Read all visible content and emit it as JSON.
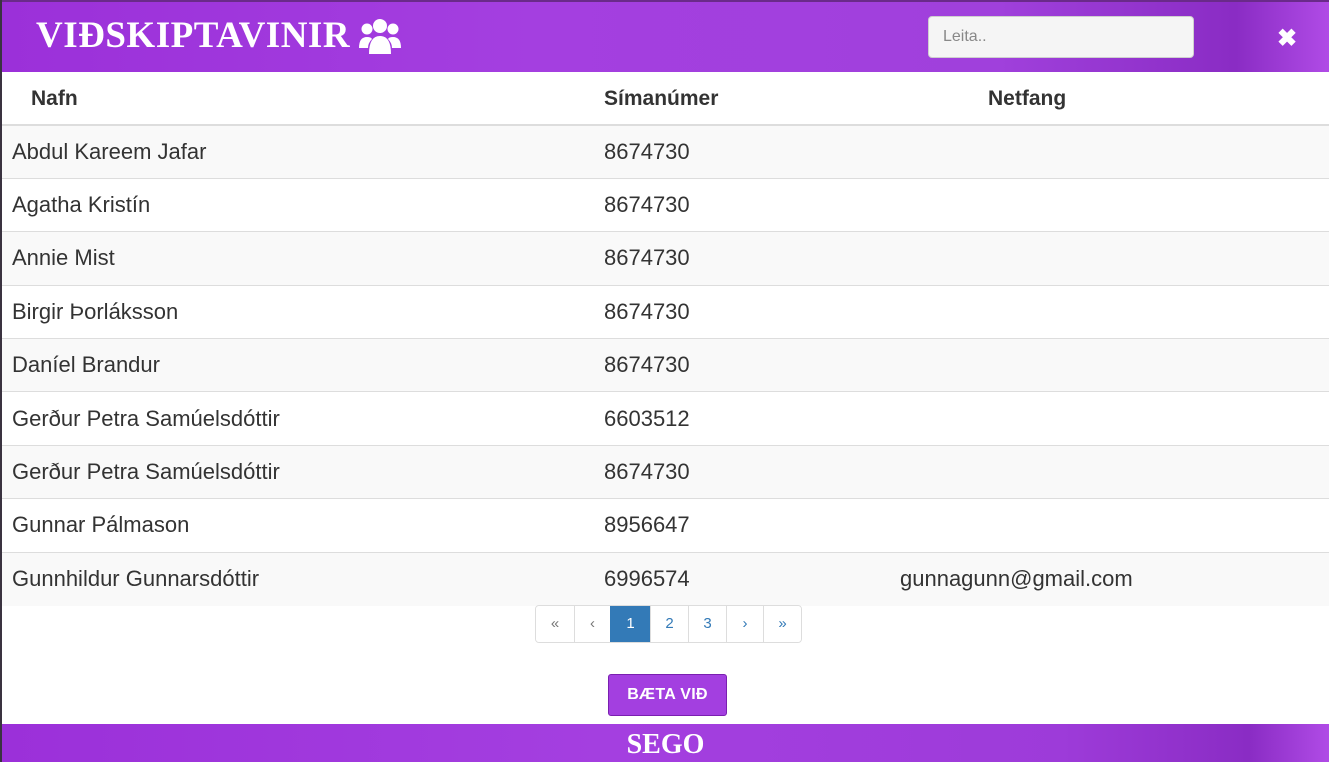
{
  "header": {
    "title": "VIÐSKIPTAVINIR",
    "title_icon": "users-icon",
    "search_placeholder": "Leita..",
    "close_icon": "close-icon",
    "close_glyph": "✖"
  },
  "table": {
    "columns": [
      "Nafn",
      "Símanúmer",
      "Netfang"
    ],
    "rows": [
      {
        "name": "Abdul Kareem Jafar",
        "phone": "8674730",
        "email": ""
      },
      {
        "name": "Agatha Kristín",
        "phone": "8674730",
        "email": ""
      },
      {
        "name": "Annie Mist",
        "phone": "8674730",
        "email": ""
      },
      {
        "name": "Birgir Þorláksson",
        "phone": "8674730",
        "email": ""
      },
      {
        "name": "Daníel Brandur",
        "phone": "8674730",
        "email": ""
      },
      {
        "name": "Gerður Petra Samúelsdóttir",
        "phone": "6603512",
        "email": ""
      },
      {
        "name": "Gerður Petra Samúelsdóttir",
        "phone": "8674730",
        "email": ""
      },
      {
        "name": "Gunnar Pálmason",
        "phone": "8956647",
        "email": ""
      },
      {
        "name": "Gunnhildur Gunnarsdóttir",
        "phone": "6996574",
        "email": "gunnagunn@gmail.com"
      }
    ]
  },
  "pagination": {
    "first": "«",
    "prev": "‹",
    "pages": [
      "1",
      "2",
      "3"
    ],
    "current_page": "1",
    "next": "›",
    "last": "»"
  },
  "actions": {
    "add_label": "BÆTA VIÐ"
  },
  "footer": {
    "brand": "SEGO"
  },
  "colors": {
    "accent": "#a33fe0",
    "pager_active": "#337ab7"
  }
}
